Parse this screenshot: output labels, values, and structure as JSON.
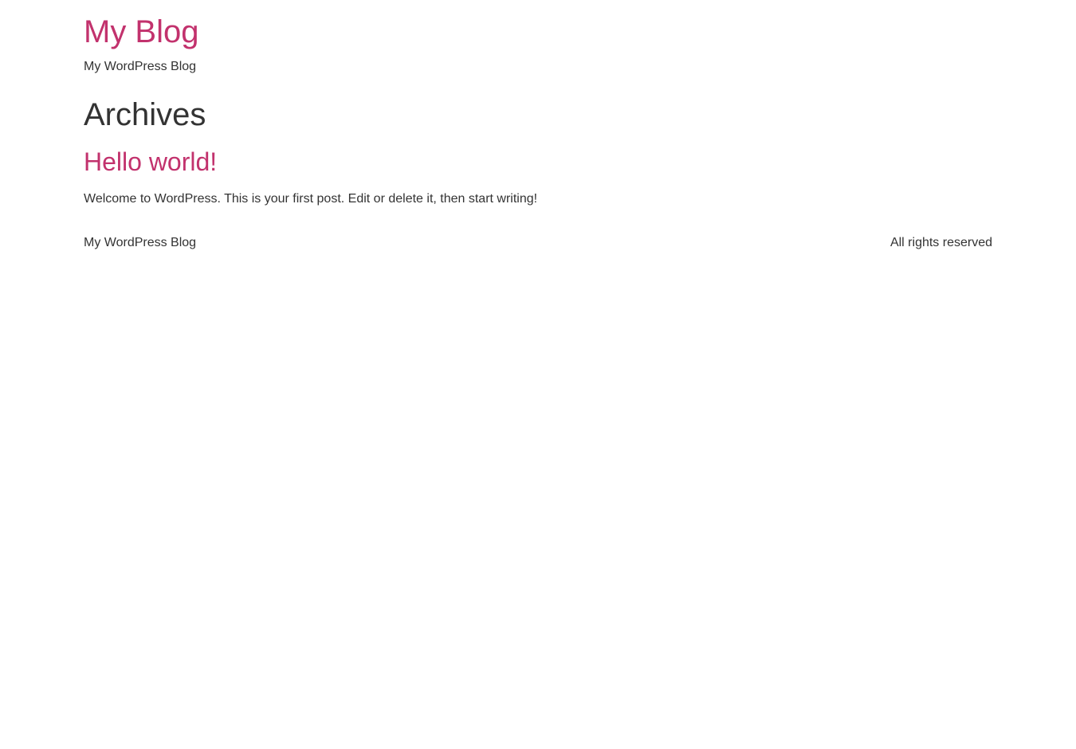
{
  "header": {
    "site_title": "My Blog",
    "site_description": "My WordPress Blog"
  },
  "main": {
    "page_title": "Archives",
    "posts": [
      {
        "title": "Hello world!",
        "excerpt": "Welcome to WordPress. This is your first post. Edit or delete it, then start writing!"
      }
    ]
  },
  "footer": {
    "left_text": "My WordPress Blog",
    "right_text": "All rights reserved"
  },
  "colors": {
    "accent": "#c2326d",
    "text": "#333333",
    "background": "#ffffff"
  }
}
